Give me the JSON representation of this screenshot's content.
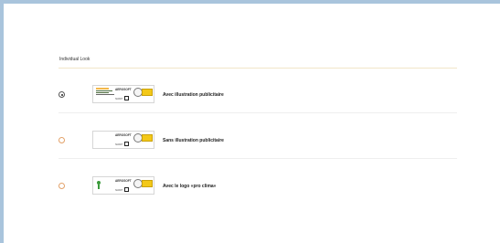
{
  "section": {
    "title": "Individual Look"
  },
  "options": [
    {
      "label": "Avec illustration publicitaire",
      "selected": true
    },
    {
      "label": "Sans illustration publicitaire",
      "selected": false
    },
    {
      "label": "Avec le logo «pro clima»",
      "selected": false
    }
  ],
  "card": {
    "wordmark": "AEROSOFT",
    "subtext": "SMART"
  },
  "colors": {
    "radio_border": "#e3a26a",
    "frame": "#a9c4dc",
    "tag_yellow": "#f3c818"
  }
}
